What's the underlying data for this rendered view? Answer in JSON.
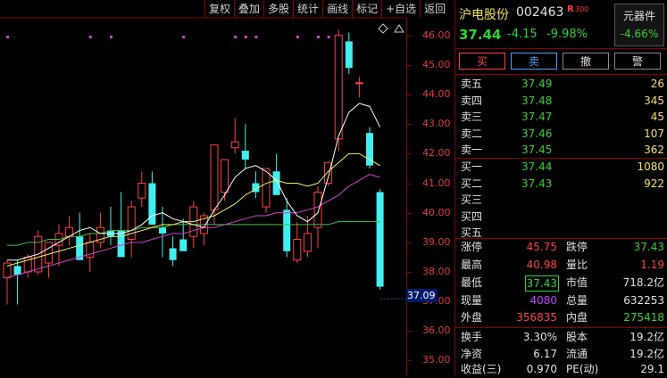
{
  "toolbar": [
    "复权",
    "叠加",
    "多股",
    "统计",
    "画线",
    "标记",
    "+自选",
    "返回"
  ],
  "stock": {
    "name": "沪电股份",
    "code": "002463",
    "badge": "R",
    "badge_sub": "300",
    "price": "37.44",
    "change": "-4.15",
    "change_pct": "-9.98%",
    "sector": "元器件",
    "sector_change": "-4.66%"
  },
  "actions": [
    "买",
    "卖",
    "撤",
    "警"
  ],
  "asks": [
    {
      "label": "卖五",
      "price": "37.49",
      "vol": "26"
    },
    {
      "label": "卖四",
      "price": "37.48",
      "vol": "345"
    },
    {
      "label": "卖三",
      "price": "37.47",
      "vol": "45"
    },
    {
      "label": "卖二",
      "price": "37.46",
      "vol": "107"
    },
    {
      "label": "卖一",
      "price": "37.45",
      "vol": "362"
    }
  ],
  "bids": [
    {
      "label": "买一",
      "price": "37.44",
      "vol": "1080"
    },
    {
      "label": "买二",
      "price": "37.43",
      "vol": "922"
    },
    {
      "label": "买三",
      "price": "",
      "vol": ""
    },
    {
      "label": "买四",
      "price": "",
      "vol": ""
    },
    {
      "label": "买五",
      "price": "",
      "vol": ""
    }
  ],
  "stats": {
    "limit_up_label": "涨停",
    "limit_up": "45.75",
    "limit_down_label": "跌停",
    "limit_down": "37.43",
    "high_label": "最高",
    "high": "40.98",
    "vol_ratio_label": "量比",
    "vol_ratio": "1.19",
    "low_label": "最低",
    "low": "37.43",
    "mktcap_label": "市值",
    "mktcap": "718.2亿",
    "cur_label": "现量",
    "cur": "4080",
    "total_label": "总量",
    "total": "632253",
    "outer_label": "外盘",
    "outer": "356835",
    "inner_label": "内盘",
    "inner": "275418",
    "turnover_label": "换手",
    "turnover": "3.30%",
    "equity_label": "股本",
    "equity": "19.2亿",
    "nav_label": "净资",
    "nav": "6.17",
    "float_label": "流通",
    "float": "19.2亿",
    "eps_label": "收益(三)",
    "eps": "0.970",
    "pe_label": "PE(动)",
    "pe": "29.1"
  },
  "price_axis": [
    "46.00",
    "45.00",
    "44.00",
    "43.00",
    "42.00",
    "41.00",
    "40.00",
    "39.00",
    "38.00",
    "37.00",
    "36.00",
    "35.00"
  ],
  "last_price_label": "37.09",
  "colors": {
    "up": "#ff4040",
    "down": "#40f0f0",
    "ma5": "#ffffff",
    "ma10": "#f0f060",
    "ma20": "#d040d0",
    "ma60": "#40c040",
    "border": "#8b0000"
  },
  "chart_data": {
    "type": "candlestick",
    "ylim": [
      34.5,
      47.2
    ],
    "candles": [
      [
        37.8,
        38.4,
        36.9,
        38.3
      ],
      [
        38.2,
        38.4,
        36.9,
        37.9
      ],
      [
        38.0,
        38.6,
        37.8,
        38.5
      ],
      [
        38.0,
        39.4,
        37.9,
        39.2
      ],
      [
        38.3,
        39.0,
        37.8,
        39.0
      ],
      [
        38.9,
        39.6,
        38.2,
        39.3
      ],
      [
        39.2,
        39.9,
        38.9,
        39.5
      ],
      [
        39.2,
        40.0,
        38.5,
        38.4
      ],
      [
        38.5,
        39.3,
        38.0,
        39.0
      ],
      [
        39.0,
        40.0,
        38.8,
        39.5
      ],
      [
        39.4,
        40.2,
        38.9,
        39.2
      ],
      [
        39.4,
        40.7,
        38.7,
        38.5
      ],
      [
        39.1,
        40.4,
        38.5,
        40.2
      ],
      [
        40.5,
        41.4,
        40.2,
        41.0
      ],
      [
        41.0,
        41.4,
        39.8,
        39.6
      ],
      [
        39.5,
        40.2,
        38.5,
        39.3
      ],
      [
        38.8,
        39.2,
        38.2,
        38.4
      ],
      [
        39.1,
        39.8,
        38.8,
        38.7
      ],
      [
        39.2,
        40.4,
        38.8,
        40.2
      ],
      [
        39.3,
        40.0,
        38.9,
        39.9
      ],
      [
        40.1,
        42.2,
        39.6,
        42.3
      ],
      [
        40.7,
        41.8,
        40.4,
        41.8
      ],
      [
        42.2,
        43.2,
        42.0,
        42.4
      ],
      [
        42.1,
        43.0,
        41.5,
        41.8
      ],
      [
        41.0,
        41.4,
        40.5,
        40.7
      ],
      [
        40.2,
        41.4,
        40.0,
        41.5
      ],
      [
        41.4,
        42.0,
        40.8,
        40.6
      ],
      [
        40.1,
        40.5,
        38.5,
        38.7
      ],
      [
        38.4,
        39.7,
        38.3,
        39.1
      ],
      [
        38.7,
        39.9,
        38.5,
        39.3
      ],
      [
        39.5,
        40.9,
        38.8,
        40.7
      ],
      [
        41.0,
        41.6,
        40.9,
        41.7
      ],
      [
        42.5,
        46.2,
        42.1,
        46.0
      ],
      [
        45.8,
        46.1,
        44.7,
        44.9
      ],
      [
        44.4,
        44.6,
        43.9,
        44.4
      ],
      [
        42.7,
        42.9,
        41.5,
        41.6
      ],
      [
        40.7,
        40.8,
        37.4,
        37.5
      ]
    ],
    "ma5": [
      38.4,
      38.4,
      38.5,
      38.6,
      38.8,
      39.0,
      39.2,
      39.4,
      39.5,
      39.3,
      39.3,
      39.3,
      39.4,
      39.6,
      39.9,
      40.0,
      39.8,
      39.7,
      39.6,
      39.5,
      40.1,
      40.6,
      41.2,
      41.5,
      41.6,
      41.4,
      41.1,
      40.4,
      39.9,
      39.7,
      40.0,
      41.2,
      42.6,
      43.4,
      43.7,
      43.6,
      42.9
    ],
    "ma10": [
      38.2,
      38.3,
      38.4,
      38.5,
      38.6,
      38.7,
      38.8,
      38.9,
      39.0,
      39.1,
      39.2,
      39.2,
      39.3,
      39.4,
      39.5,
      39.6,
      39.6,
      39.7,
      39.7,
      39.8,
      39.9,
      40.1,
      40.3,
      40.6,
      40.8,
      41.0,
      41.1,
      41.0,
      41.0,
      40.9,
      41.0,
      41.4,
      41.7,
      42.0,
      42.0,
      41.8,
      41.6
    ],
    "ma20": [
      37.8,
      37.9,
      38.0,
      38.1,
      38.2,
      38.3,
      38.4,
      38.5,
      38.6,
      38.7,
      38.8,
      38.9,
      39.0,
      39.0,
      39.1,
      39.2,
      39.3,
      39.3,
      39.4,
      39.5,
      39.5,
      39.6,
      39.7,
      39.8,
      39.9,
      39.9,
      40.0,
      40.0,
      40.0,
      40.1,
      40.2,
      40.4,
      40.6,
      40.9,
      41.1,
      41.3,
      41.2
    ],
    "ma60": [
      38.9,
      38.9,
      39.0,
      39.0,
      39.1,
      39.1,
      39.2,
      39.2,
      39.3,
      39.3,
      39.4,
      39.4,
      39.4,
      39.5,
      39.5,
      39.5,
      39.6,
      39.6,
      39.6,
      39.6,
      39.6,
      39.6,
      39.6,
      39.6,
      39.6,
      39.6,
      39.6,
      39.6,
      39.6,
      39.6,
      39.6,
      39.6,
      39.7,
      39.7,
      39.7,
      39.7,
      39.7
    ],
    "signal_marks": [
      0,
      8,
      10,
      17,
      22,
      23,
      24,
      28,
      30,
      31
    ]
  }
}
